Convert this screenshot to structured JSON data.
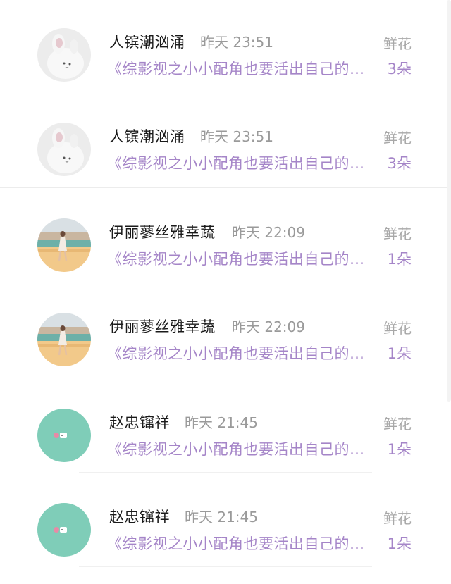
{
  "items": [
    {
      "name": "人镔潮汹涌",
      "time": "昨天 23:51",
      "book": "《综影视之小小配角也要活出自己的…",
      "gift_type": "鲜花",
      "gift_count": "3朵",
      "avatar_icon": "rabbit-avatar-icon"
    },
    {
      "name": "人镔潮汹涌",
      "time": "昨天 23:51",
      "book": "《综影视之小小配角也要活出自己的…",
      "gift_type": "鲜花",
      "gift_count": "3朵",
      "avatar_icon": "rabbit-avatar-icon"
    },
    {
      "name": "伊丽蓼丝雅幸蔬",
      "time": "昨天 22:09",
      "book": "《综影视之小小配角也要活出自己的…",
      "gift_type": "鲜花",
      "gift_count": "1朵",
      "avatar_icon": "beach-photo-avatar-icon"
    },
    {
      "name": "伊丽蓼丝雅幸蔬",
      "time": "昨天 22:09",
      "book": "《综影视之小小配角也要活出自己的…",
      "gift_type": "鲜花",
      "gift_count": "1朵",
      "avatar_icon": "beach-photo-avatar-icon"
    },
    {
      "name": "赵忠镩祥",
      "time": "昨天 21:45",
      "book": "《综影视之小小配角也要活出自己的…",
      "gift_type": "鲜花",
      "gift_count": "1朵",
      "avatar_icon": "teal-circle-avatar-icon"
    },
    {
      "name": "赵忠镩祥",
      "time": "昨天 21:45",
      "book": "《综影视之小小配角也要活出自己的…",
      "gift_type": "鲜花",
      "gift_count": "1朵",
      "avatar_icon": "teal-circle-avatar-icon"
    }
  ],
  "colors": {
    "accent_purple": "#a585c8",
    "avatar_teal": "#7fcdb8"
  }
}
